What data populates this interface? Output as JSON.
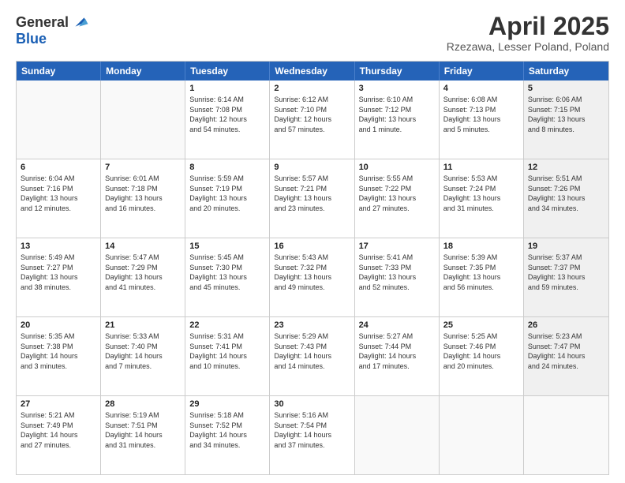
{
  "header": {
    "logo_general": "General",
    "logo_blue": "Blue",
    "title": "April 2025",
    "location": "Rzezawa, Lesser Poland, Poland"
  },
  "days_of_week": [
    "Sunday",
    "Monday",
    "Tuesday",
    "Wednesday",
    "Thursday",
    "Friday",
    "Saturday"
  ],
  "weeks": [
    [
      {
        "day": "",
        "info": "",
        "empty": true
      },
      {
        "day": "",
        "info": "",
        "empty": true
      },
      {
        "day": "1",
        "info": "Sunrise: 6:14 AM\nSunset: 7:08 PM\nDaylight: 12 hours\nand 54 minutes."
      },
      {
        "day": "2",
        "info": "Sunrise: 6:12 AM\nSunset: 7:10 PM\nDaylight: 12 hours\nand 57 minutes."
      },
      {
        "day": "3",
        "info": "Sunrise: 6:10 AM\nSunset: 7:12 PM\nDaylight: 13 hours\nand 1 minute."
      },
      {
        "day": "4",
        "info": "Sunrise: 6:08 AM\nSunset: 7:13 PM\nDaylight: 13 hours\nand 5 minutes."
      },
      {
        "day": "5",
        "info": "Sunrise: 6:06 AM\nSunset: 7:15 PM\nDaylight: 13 hours\nand 8 minutes.",
        "shaded": true
      }
    ],
    [
      {
        "day": "6",
        "info": "Sunrise: 6:04 AM\nSunset: 7:16 PM\nDaylight: 13 hours\nand 12 minutes."
      },
      {
        "day": "7",
        "info": "Sunrise: 6:01 AM\nSunset: 7:18 PM\nDaylight: 13 hours\nand 16 minutes."
      },
      {
        "day": "8",
        "info": "Sunrise: 5:59 AM\nSunset: 7:19 PM\nDaylight: 13 hours\nand 20 minutes."
      },
      {
        "day": "9",
        "info": "Sunrise: 5:57 AM\nSunset: 7:21 PM\nDaylight: 13 hours\nand 23 minutes."
      },
      {
        "day": "10",
        "info": "Sunrise: 5:55 AM\nSunset: 7:22 PM\nDaylight: 13 hours\nand 27 minutes."
      },
      {
        "day": "11",
        "info": "Sunrise: 5:53 AM\nSunset: 7:24 PM\nDaylight: 13 hours\nand 31 minutes."
      },
      {
        "day": "12",
        "info": "Sunrise: 5:51 AM\nSunset: 7:26 PM\nDaylight: 13 hours\nand 34 minutes.",
        "shaded": true
      }
    ],
    [
      {
        "day": "13",
        "info": "Sunrise: 5:49 AM\nSunset: 7:27 PM\nDaylight: 13 hours\nand 38 minutes."
      },
      {
        "day": "14",
        "info": "Sunrise: 5:47 AM\nSunset: 7:29 PM\nDaylight: 13 hours\nand 41 minutes."
      },
      {
        "day": "15",
        "info": "Sunrise: 5:45 AM\nSunset: 7:30 PM\nDaylight: 13 hours\nand 45 minutes."
      },
      {
        "day": "16",
        "info": "Sunrise: 5:43 AM\nSunset: 7:32 PM\nDaylight: 13 hours\nand 49 minutes."
      },
      {
        "day": "17",
        "info": "Sunrise: 5:41 AM\nSunset: 7:33 PM\nDaylight: 13 hours\nand 52 minutes."
      },
      {
        "day": "18",
        "info": "Sunrise: 5:39 AM\nSunset: 7:35 PM\nDaylight: 13 hours\nand 56 minutes."
      },
      {
        "day": "19",
        "info": "Sunrise: 5:37 AM\nSunset: 7:37 PM\nDaylight: 13 hours\nand 59 minutes.",
        "shaded": true
      }
    ],
    [
      {
        "day": "20",
        "info": "Sunrise: 5:35 AM\nSunset: 7:38 PM\nDaylight: 14 hours\nand 3 minutes."
      },
      {
        "day": "21",
        "info": "Sunrise: 5:33 AM\nSunset: 7:40 PM\nDaylight: 14 hours\nand 7 minutes."
      },
      {
        "day": "22",
        "info": "Sunrise: 5:31 AM\nSunset: 7:41 PM\nDaylight: 14 hours\nand 10 minutes."
      },
      {
        "day": "23",
        "info": "Sunrise: 5:29 AM\nSunset: 7:43 PM\nDaylight: 14 hours\nand 14 minutes."
      },
      {
        "day": "24",
        "info": "Sunrise: 5:27 AM\nSunset: 7:44 PM\nDaylight: 14 hours\nand 17 minutes."
      },
      {
        "day": "25",
        "info": "Sunrise: 5:25 AM\nSunset: 7:46 PM\nDaylight: 14 hours\nand 20 minutes."
      },
      {
        "day": "26",
        "info": "Sunrise: 5:23 AM\nSunset: 7:47 PM\nDaylight: 14 hours\nand 24 minutes.",
        "shaded": true
      }
    ],
    [
      {
        "day": "27",
        "info": "Sunrise: 5:21 AM\nSunset: 7:49 PM\nDaylight: 14 hours\nand 27 minutes."
      },
      {
        "day": "28",
        "info": "Sunrise: 5:19 AM\nSunset: 7:51 PM\nDaylight: 14 hours\nand 31 minutes."
      },
      {
        "day": "29",
        "info": "Sunrise: 5:18 AM\nSunset: 7:52 PM\nDaylight: 14 hours\nand 34 minutes."
      },
      {
        "day": "30",
        "info": "Sunrise: 5:16 AM\nSunset: 7:54 PM\nDaylight: 14 hours\nand 37 minutes."
      },
      {
        "day": "",
        "info": "",
        "empty": true
      },
      {
        "day": "",
        "info": "",
        "empty": true
      },
      {
        "day": "",
        "info": "",
        "empty": true,
        "shaded": true
      }
    ]
  ]
}
